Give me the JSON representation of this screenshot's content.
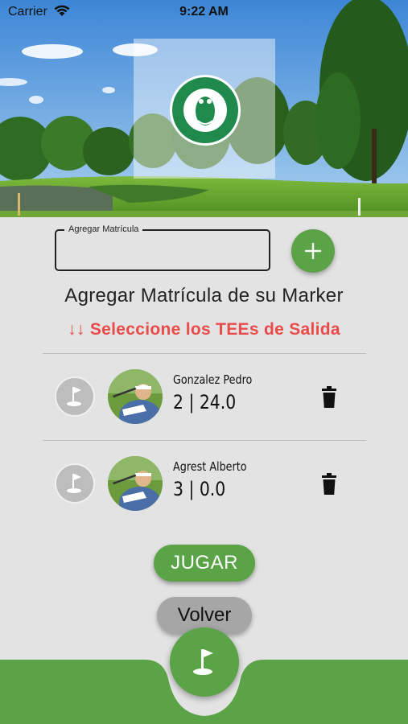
{
  "status_bar": {
    "carrier": "Carrier",
    "time": "9:22 AM"
  },
  "header": {
    "logo_alt": "Los Lagartos Country Club"
  },
  "form": {
    "field_label": "Agregar Matrícula",
    "field_value": "",
    "add_icon": "plus-icon"
  },
  "marker_title": "Agregar Matrícula de su Marker",
  "tees_title": "↓↓ Seleccione los TEEs de Salida",
  "players": [
    {
      "name": "Gonzalez Pedro",
      "value": "2 | 24.0"
    },
    {
      "name": "Agrest Alberto",
      "value": "3 | 0.0"
    }
  ],
  "buttons": {
    "jugar": "JUGAR",
    "volver": "Volver"
  },
  "colors": {
    "primary_green": "#5aa447",
    "warning_red": "#ea4a4a",
    "background": "#e3e3e3"
  }
}
